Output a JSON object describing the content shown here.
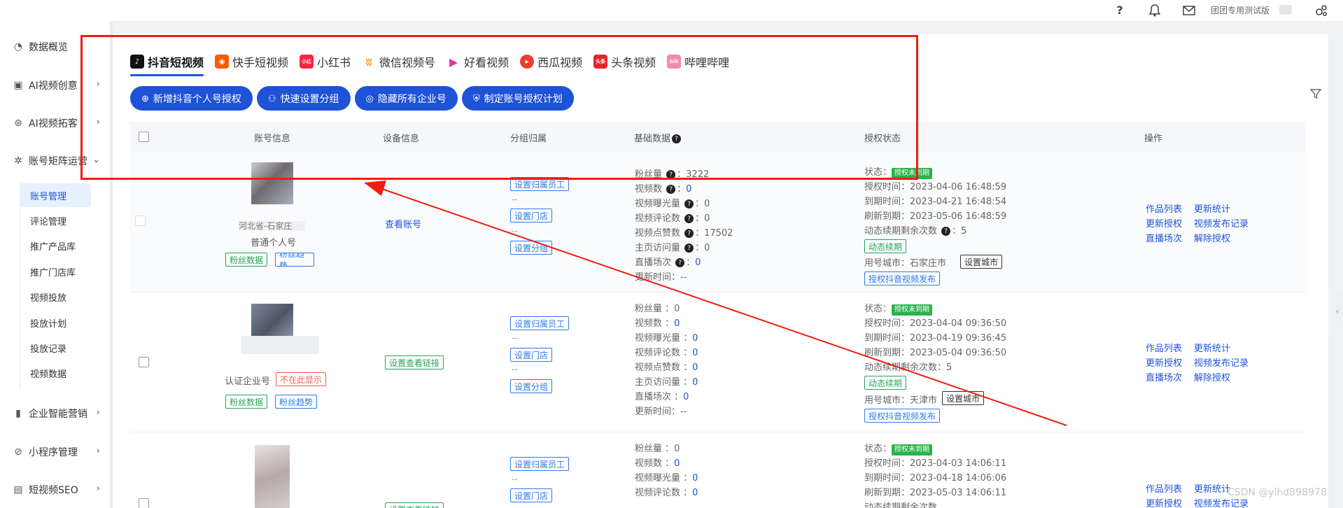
{
  "header": {
    "help_icon": "question-icon",
    "bell_icon": "bell-icon",
    "mail_icon": "mail-icon",
    "user_label": "团团专用测试版",
    "settings_icon": "gear-cluster-icon"
  },
  "sidebar": {
    "items": [
      {
        "label": "数据概览",
        "icon": "dashboard-icon"
      },
      {
        "label": "AI视频创意",
        "icon": "ai-video-icon",
        "chevron": "›"
      },
      {
        "label": "AI视频拓客",
        "icon": "ai-expand-icon",
        "chevron": "›"
      },
      {
        "label": "账号矩阵运营",
        "icon": "matrix-icon",
        "chevron": "⌄"
      },
      {
        "label": "企业智能营销",
        "icon": "bar-chart-icon",
        "chevron": "›"
      },
      {
        "label": "小程序管理",
        "icon": "mini-program-icon",
        "chevron": "›"
      },
      {
        "label": "短视频SEO",
        "icon": "seo-icon",
        "chevron": "›"
      }
    ],
    "sub_items": [
      "账号管理",
      "评论管理",
      "推广产品库",
      "推广门店库",
      "视频投放",
      "投放计划",
      "投放记录",
      "视频数据"
    ],
    "active_sub": "账号管理"
  },
  "tabs": [
    {
      "label": "抖音短视频",
      "icon": "douyin-icon",
      "color": "#111111"
    },
    {
      "label": "快手短视频",
      "icon": "kuaishou-icon",
      "color": "#ff5a00"
    },
    {
      "label": "小红书",
      "icon": "xiaohongshu-icon",
      "color": "#ff2442"
    },
    {
      "label": "微信视频号",
      "icon": "wechat-channels-icon",
      "color": "#fa9d3b"
    },
    {
      "label": "好看视频",
      "icon": "haokan-icon",
      "color": "#e03a9b"
    },
    {
      "label": "西瓜视频",
      "icon": "xigua-icon",
      "color": "#f03d2f"
    },
    {
      "label": "头条视频",
      "icon": "toutiao-icon",
      "color": "#e8232b"
    },
    {
      "label": "哔哩哔哩",
      "icon": "bilibili-icon",
      "color": "#f28ca6"
    }
  ],
  "toolbar": {
    "buttons": [
      {
        "label": "新增抖音个人号授权",
        "icon": "plus-circle-icon"
      },
      {
        "label": "快速设置分组",
        "icon": "group-icon"
      },
      {
        "label": "隐藏所有企业号",
        "icon": "eye-off-icon"
      },
      {
        "label": "制定账号授权计划",
        "icon": "shield-icon"
      }
    ],
    "filter_icon": "filter-icon"
  },
  "table": {
    "columns": [
      "账号信息",
      "设备信息",
      "分组归属",
      "基础数据",
      "授权状态",
      "操作"
    ],
    "stat_labels": {
      "fans": "粉丝量",
      "videos": "视频数",
      "exposure": "视频曝光量",
      "comments": "视频评论数",
      "likes": "视频点赞数",
      "home_visits": "主页访问量",
      "live": "直播场次",
      "updated": "更新时间："
    },
    "auth_labels": {
      "status": "状态：",
      "auth_time": "授权时间：",
      "expire": "到期时间：",
      "refresh": "刷新到期：",
      "renew_left": "动态续期剩余次数",
      "city": "用号城市："
    },
    "action_labels": {
      "works": "作品列表",
      "update_stats": "更新统计",
      "update_auth": "更新授权",
      "publish_log": "视频发布记录",
      "live_sessions": "直播场次",
      "revoke": "解除授权"
    },
    "tag_labels": {
      "fan_data": "粉丝数据",
      "fan_trend": "粉丝趋势",
      "assign_staff": "设置归属员工",
      "set_store": "设置门店",
      "set_group": "设置分组",
      "renew": "动态续期",
      "set_city": "设置城市",
      "auth_publish": "授权抖音视频发布",
      "hidden": "不在此显示",
      "view_link": "设置查看链接"
    },
    "rows": [
      {
        "name": "河北省-石家庄",
        "type": "普通个人号",
        "device": "查看账号",
        "fans": "：3222",
        "videos": "0",
        "exposure": "：0",
        "comments": "：0",
        "likes": "：17502",
        "home_visits": "：0",
        "live": "0",
        "updated": "--",
        "status": "授权未到期",
        "auth_time": "2023-04-06 16:48:59",
        "expire": "2023-04-21 16:48:54",
        "refresh": "2023-05-06 16:48:59",
        "renew_left": "：5",
        "city": "石家庄市"
      },
      {
        "name": "",
        "type": "认证企业号",
        "device": "设置查看链接",
        "fans": "：0",
        "videos": "0",
        "exposure": "0",
        "comments": "0",
        "likes": "0",
        "home_visits": "0",
        "live": "0",
        "updated": "--",
        "status": "授权未到期",
        "auth_time": "2023-04-04 09:36:50",
        "expire": "2023-04-19 09:36:45",
        "refresh": "2023-05-04 09:36:50",
        "renew_left": "：5",
        "city": "天津市"
      },
      {
        "name": "",
        "type": "",
        "device": "设置查看链接",
        "fans": "：0",
        "videos": "0",
        "exposure": "0",
        "comments": "0",
        "likes": "",
        "home_visits": "",
        "live": "",
        "updated": "",
        "status": "授权未到期",
        "auth_time": "2023-04-03 14:06:11",
        "expire": "2023-04-18 14:06:06",
        "refresh": "2023-05-03 14:06:11",
        "renew_left": "",
        "city": ""
      }
    ]
  },
  "watermark": "CSDN @ylhd898978",
  "annotation": {
    "box_color": "#f21d12"
  }
}
